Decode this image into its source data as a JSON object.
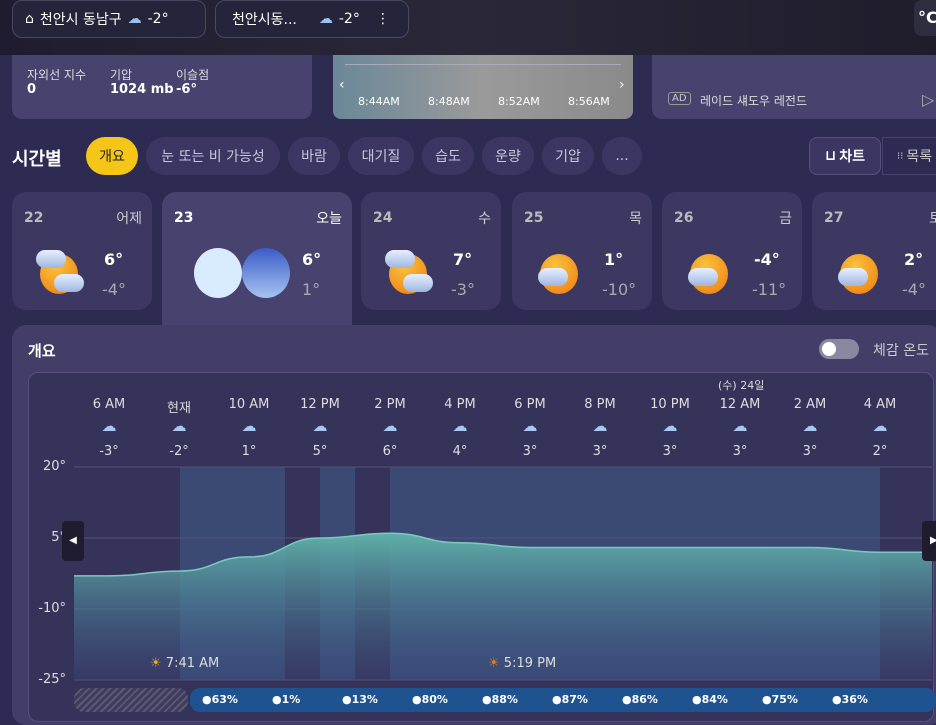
{
  "top": {
    "locations": [
      {
        "name": "천안시 동남구",
        "temp": "-2°"
      },
      {
        "name": "천안시동...",
        "temp": "-2°"
      }
    ],
    "unit": "°C"
  },
  "details": {
    "items": [
      {
        "label": "자외선 지수",
        "value": "0"
      },
      {
        "label": "기압",
        "value": "1024 mb"
      },
      {
        "label": "이슬점",
        "value": "-6°"
      }
    ]
  },
  "radar": {
    "times": [
      "8:44AM",
      "8:48AM",
      "8:52AM",
      "8:56AM"
    ]
  },
  "ad": {
    "badge": "AD",
    "text": "레이드 섀도우 레전드"
  },
  "hourly": {
    "title": "시간별",
    "tabs": [
      "개요",
      "눈 또는 비 가능성",
      "바람",
      "대기질",
      "습도",
      "운량",
      "기압",
      "..."
    ],
    "chart_btn": "차트",
    "list_btn": "목록"
  },
  "days": [
    {
      "date": "22",
      "label": "어제",
      "hi": "6°",
      "lo": "-4°"
    },
    {
      "date": "23",
      "label": "오늘",
      "hi": "6°",
      "lo": "1°"
    },
    {
      "date": "24",
      "label": "수",
      "hi": "7°",
      "lo": "-3°"
    },
    {
      "date": "25",
      "label": "목",
      "hi": "1°",
      "lo": "-10°"
    },
    {
      "date": "26",
      "label": "금",
      "hi": "-4°",
      "lo": "-11°"
    },
    {
      "date": "27",
      "label": "토",
      "hi": "2°",
      "lo": "-4°"
    }
  ],
  "overview": {
    "title": "개요",
    "feels_like": "체감 온도",
    "next_day": "(수) 24일",
    "hours": [
      {
        "t": "6 AM",
        "v": "-3°",
        "n": -3
      },
      {
        "t": "현재",
        "v": "-2°",
        "n": -2
      },
      {
        "t": "10 AM",
        "v": "1°",
        "n": 1
      },
      {
        "t": "12 PM",
        "v": "5°",
        "n": 5
      },
      {
        "t": "2 PM",
        "v": "6°",
        "n": 6
      },
      {
        "t": "4 PM",
        "v": "4°",
        "n": 4
      },
      {
        "t": "6 PM",
        "v": "3°",
        "n": 3
      },
      {
        "t": "8 PM",
        "v": "3°",
        "n": 3
      },
      {
        "t": "10 PM",
        "v": "3°",
        "n": 3
      },
      {
        "t": "12 AM",
        "v": "3°",
        "n": 3
      },
      {
        "t": "2 AM",
        "v": "3°",
        "n": 3
      },
      {
        "t": "4 AM",
        "v": "2°",
        "n": 2
      }
    ],
    "yticks": [
      "20°",
      "5°",
      "-10°",
      "-25°"
    ],
    "sunrise": "7:41 AM",
    "sunset": "5:19 PM",
    "precip": [
      "63%",
      "1%",
      "13%",
      "80%",
      "88%",
      "87%",
      "86%",
      "84%",
      "75%",
      "36%"
    ]
  }
}
